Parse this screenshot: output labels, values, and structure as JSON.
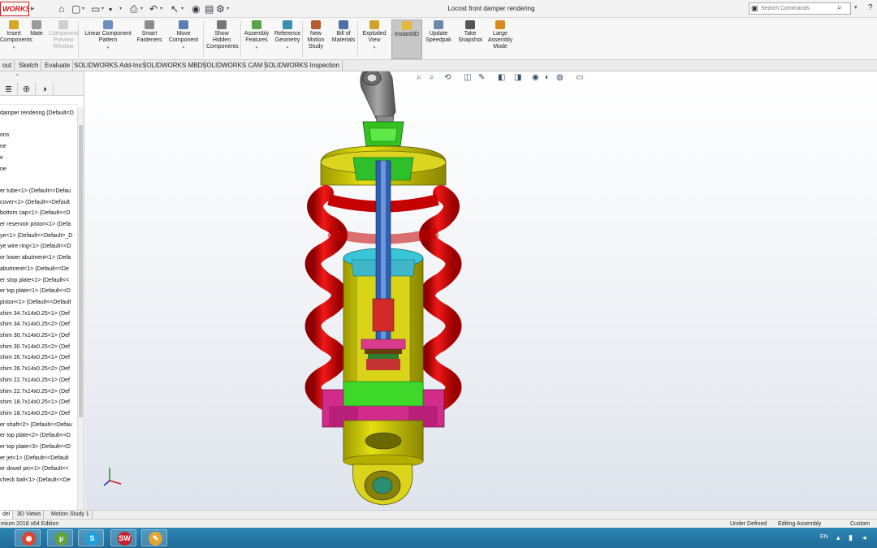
{
  "app": {
    "logo_text": "WORKS",
    "document_title": "Locost front damper rendering",
    "search_placeholder": "Search Commands",
    "help_glyph": "?"
  },
  "quick_access": [
    {
      "name": "home-icon",
      "glyph": "⌂"
    },
    {
      "name": "new-document-icon",
      "glyph": "▢"
    },
    {
      "name": "open-icon",
      "glyph": "▭"
    },
    {
      "name": "save-icon",
      "glyph": "▪"
    },
    {
      "name": "print-icon",
      "glyph": "⎙"
    },
    {
      "name": "undo-icon",
      "glyph": "↶"
    },
    {
      "name": "select-icon",
      "glyph": "↖"
    },
    {
      "name": "rebuild-icon",
      "glyph": "◉"
    },
    {
      "name": "file-properties-icon",
      "glyph": "▤"
    },
    {
      "name": "options-icon",
      "glyph": "⚙"
    }
  ],
  "ribbon": {
    "buttons": [
      {
        "name": "insert-components-button",
        "label1": "Insert",
        "label2": "Components",
        "label3": "",
        "color": "#d9a526",
        "caret": true,
        "disabled": false,
        "active": false
      },
      {
        "name": "mate-button",
        "label1": "Mate",
        "label2": "",
        "label3": "",
        "color": "#9a9a9a",
        "caret": false,
        "disabled": false,
        "active": false
      },
      {
        "name": "component-preview-button",
        "label1": "Component",
        "label2": "Preview",
        "label3": "Window",
        "color": "#cfcfcf",
        "caret": false,
        "disabled": true,
        "active": false
      },
      {
        "name": "linear-component-pattern-button",
        "label1": "Linear Component",
        "label2": "Pattern",
        "label3": "",
        "color": "#6d8fbf",
        "caret": true,
        "disabled": false,
        "active": false
      },
      {
        "name": "smart-fasteners-button",
        "label1": "Smart",
        "label2": "Fasteners",
        "label3": "",
        "color": "#8c8c8c",
        "caret": false,
        "disabled": false,
        "active": false
      },
      {
        "name": "move-component-button",
        "label1": "Move",
        "label2": "Component",
        "label3": "",
        "color": "#5a7fb3",
        "caret": true,
        "disabled": false,
        "active": false
      },
      {
        "name": "show-hidden-components-button",
        "label1": "Show",
        "label2": "Hidden",
        "label3": "Components",
        "color": "#777777",
        "caret": false,
        "disabled": false,
        "active": false
      },
      {
        "name": "assembly-features-button",
        "label1": "Assembly",
        "label2": "Features",
        "label3": "",
        "color": "#5aa34a",
        "caret": true,
        "disabled": false,
        "active": false
      },
      {
        "name": "reference-geometry-button",
        "label1": "Reference",
        "label2": "Geometry",
        "label3": "",
        "color": "#3a8fb0",
        "caret": true,
        "disabled": false,
        "active": false
      },
      {
        "name": "new-motion-study-button",
        "label1": "New",
        "label2": "Motion",
        "label3": "Study",
        "color": "#b85c2f",
        "caret": false,
        "disabled": false,
        "active": false
      },
      {
        "name": "bill-of-materials-button",
        "label1": "Bill of",
        "label2": "Materials",
        "label3": "",
        "color": "#4d6fa3",
        "caret": false,
        "disabled": false,
        "active": false
      },
      {
        "name": "exploded-view-button",
        "label1": "Exploded",
        "label2": "View",
        "label3": "",
        "color": "#d0a331",
        "caret": true,
        "disabled": false,
        "active": false
      },
      {
        "name": "instant3d-button",
        "label1": "Instant3D",
        "label2": "",
        "label3": "",
        "color": "#e3b73c",
        "caret": false,
        "disabled": false,
        "active": true
      },
      {
        "name": "update-speedpak-button",
        "label1": "Update",
        "label2": "Speedpak",
        "label3": "",
        "color": "#6d88a8",
        "caret": false,
        "disabled": false,
        "active": false
      },
      {
        "name": "take-snapshot-button",
        "label1": "Take",
        "label2": "Snapshot",
        "label3": "",
        "color": "#555555",
        "caret": false,
        "disabled": false,
        "active": false
      },
      {
        "name": "large-assembly-mode-button",
        "label1": "Large",
        "label2": "Assembly",
        "label3": "Mode",
        "color": "#d88a1f",
        "caret": false,
        "disabled": false,
        "active": false
      }
    ]
  },
  "command_tabs": [
    "out",
    "Sketch",
    "Evaluate",
    "SOLIDWORKS Add-Ins",
    "SOLIDWORKS MBD",
    "SOLIDWORKS CAM",
    "SOLIDWORKS Inspection"
  ],
  "heads_up": [
    {
      "name": "zoom-to-fit-icon",
      "glyph": "⌕"
    },
    {
      "name": "zoom-area-icon",
      "glyph": "⌕"
    },
    {
      "name": "previous-view-icon",
      "glyph": "⟲"
    },
    {
      "name": "section-view-icon",
      "glyph": "◫"
    },
    {
      "name": "dynamic-annotation-icon",
      "glyph": "✎"
    },
    {
      "name": "view-orientation-icon",
      "glyph": "◧"
    },
    {
      "name": "display-style-icon",
      "glyph": "◨"
    },
    {
      "name": "hide-show-items-icon",
      "glyph": "◉"
    },
    {
      "name": "edit-appearance-icon",
      "glyph": "◐"
    },
    {
      "name": "apply-scene-icon",
      "glyph": "◍"
    },
    {
      "name": "view-settings-icon",
      "glyph": "▭"
    }
  ],
  "feature_tree": {
    "filter_icon": "⊞",
    "panel_tabs": [
      "≣",
      "⊕",
      "◑"
    ],
    "items": [
      "damper rendering  (Default<D",
      "",
      "ons",
      "ne",
      "e",
      "ne",
      "",
      "er tube<1> (Default<<Defau",
      "cover<1> (Default<<Default",
      "bottom cap<1> (Default<<D",
      "er reservoir piston<1> (Defa",
      "ye<1> (Default<<Default>_D",
      "ye wire ring<1> (Default<<D",
      "er lower abutment<1> (Defa",
      " abutment<1> (Default<<De",
      "er stop plate<1> (Default<<",
      "er top plate<1> (Default<<D",
      "piston<1> (Default<<Default",
      " shim 34.7x14x0.25<1> (Def",
      " shim 34.7x14x0.25<2> (Def",
      " shim 30.7x14x0.25<1> (Def",
      " shim 30.7x14x0.25<2> (Def",
      " shim 26.7x14x0.25<1> (Def",
      " shim 26.7x14x0.25<2> (Def",
      " shim 22.7x14x0.25<1> (Def",
      " shim 22.7x14x0.25<2> (Def",
      " shim 18.7x14x0.25<1> (Def",
      " shim 18.7x14x0.25<2> (Def",
      "er shaft<2> (Default<<Defau",
      "er top plate<2> (Default<<D",
      "er top plate<3> (Default<<D",
      "er jet<1> (Default<<Default",
      "er dowel pin<1> (Default<<",
      " check ball<1> (Default<<De"
    ]
  },
  "bottom_tabs": [
    "del",
    "3D Views",
    "Motion Study 1"
  ],
  "status": {
    "edition": "mium 2018 x64 Edition",
    "definition": "Under Defined",
    "mode": "Editing Assembly",
    "units": "Custom"
  },
  "taskbar": {
    "apps": [
      {
        "name": "start-button-icon",
        "glyph": "",
        "color": "transparent"
      },
      {
        "name": "ie-icon",
        "glyph": "e",
        "color": "#2c8ad6"
      },
      {
        "name": "chrome-icon",
        "glyph": "◉",
        "color": "#d9452f"
      },
      {
        "name": "utorrent-icon",
        "glyph": "µ",
        "color": "#5fa33c"
      },
      {
        "name": "skype-icon",
        "glyph": "S",
        "color": "#1ea0dc"
      },
      {
        "name": "solidworks-taskbar-icon",
        "glyph": "SW",
        "color": "#c8202a"
      },
      {
        "name": "paint-icon",
        "glyph": "✎",
        "color": "#e3a430"
      }
    ],
    "language": "EN"
  },
  "colors": {
    "spring": "#dd0000",
    "body_yellow": "#d8d200",
    "top_cap": "#d9cf1f",
    "green_part": "#3cd62a",
    "cyan_part": "#3ec8d8",
    "magenta_part": "#d6268a",
    "rod_end": "#7d7d7d"
  }
}
